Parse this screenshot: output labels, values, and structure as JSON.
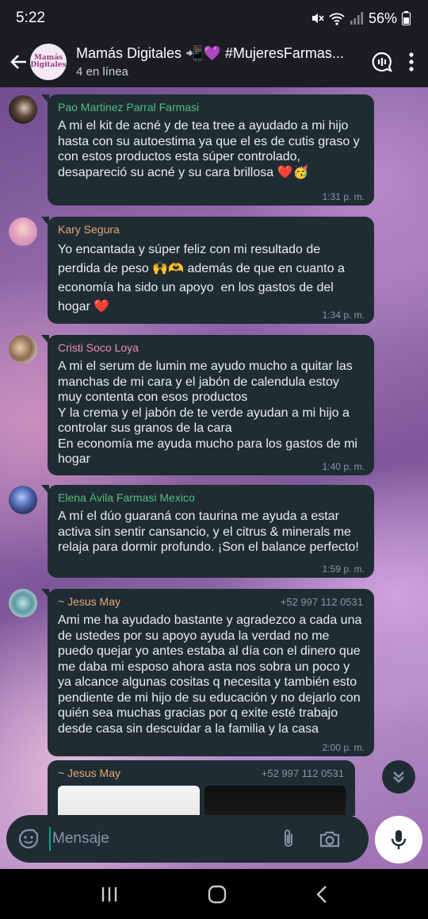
{
  "status_bar": {
    "time": "5:22",
    "battery": "56%"
  },
  "header": {
    "title": "Mamás Digitales 📲💜 #MujeresFarmas...",
    "subtitle": "4 en línea",
    "avatar_text": "Mamás Digitales"
  },
  "messages": [
    {
      "sender": "Pao Martinez Parral Farmasi",
      "sender_color": "#53bd7e",
      "text": "A mi el kit de acné y de tea tree a ayudado a mi hijo hasta con su autoestima ya que el es de cutis graso y con estos productos esta súper controlado, desapareció su acné y su cara brillosa ❤️🥳",
      "time": "1:31 p. m."
    },
    {
      "sender": "Kary Segura",
      "sender_color": "#e6a774",
      "text": "Yo encantada y súper feliz con mi resultado de perdida de peso 🙌🫶 además de que en cuanto a economía ha sido un apoyo  en los gastos de del hogar ❤️",
      "time": "1:34 p. m."
    },
    {
      "sender": "Cristi Soco Loya",
      "sender_color": "#f08bb4",
      "text": "A mi el serum de lumin me ayudo mucho a quitar las manchas de mi cara y el jabón de calendula estoy muy contenta con esos productos\nY la crema y el jabón de te verde ayudan a mi hijo a controlar sus granos de la cara\nEn economía me ayuda mucho para los gastos de mi hogar",
      "time": "1:40 p. m."
    },
    {
      "sender": "Elena Ávila Farmasi Mexico",
      "sender_color": "#53bd7e",
      "text": "A mí el dúo guaraná con taurina me ayuda a estar activa sin sentir cansancio, y el citrus & minerals me relaja para dormir profundo. ¡Son el balance perfecto!",
      "time": "1:59 p. m."
    },
    {
      "sender": "~ Jesus May",
      "sender_color": "#e6a774",
      "phone": "+52 997 112 0531",
      "text": "Ami me ha ayudado bastante y agradezco a cada una de ustedes por su apoyo ayuda la verdad no me puedo quejar yo antes estaba al día con el dinero que me daba mi esposo ahora asta nos sobra un poco y ya alcance algunas cositas q necesita y también esto pendiente de mi hijo de su educación y no dejarlo con quién sea muchas gracias por q exite esté trabajo desde casa sin descuidar a la familia y la casa",
      "time": "2:00 p. m."
    },
    {
      "sender": "~ Jesus May",
      "sender_color": "#e6a774",
      "phone": "+52 997 112 0531"
    }
  ],
  "composer": {
    "placeholder": "Mensaje"
  },
  "colors": {
    "bubble": "#1f2c34",
    "header": "#1b1d22",
    "accent": "#00a884"
  }
}
